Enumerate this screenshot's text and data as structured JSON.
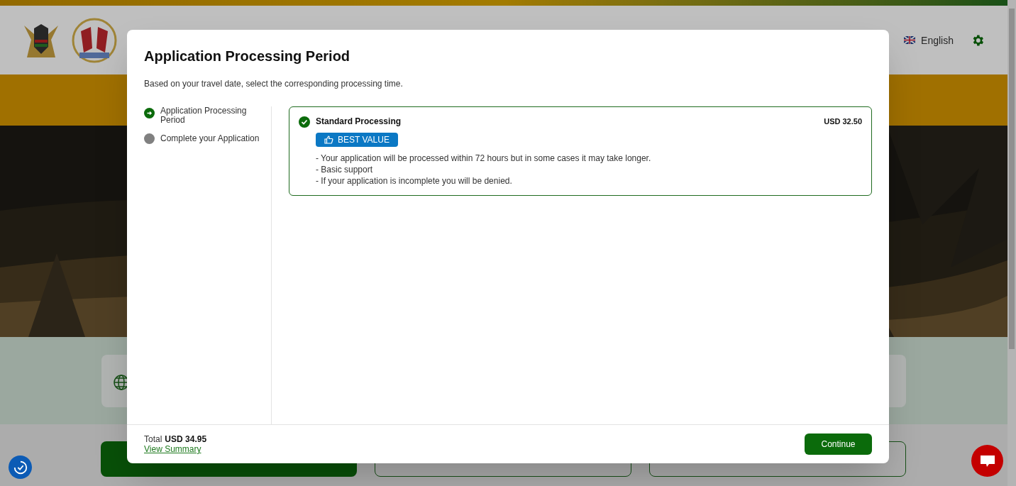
{
  "header": {
    "language": "English"
  },
  "modal": {
    "title": "Application Processing Period",
    "subtitle": "Based on your travel date, select the corresponding processing time.",
    "steps": [
      {
        "label": "Application Processing Period",
        "selected": true
      },
      {
        "label": "Complete your Application",
        "selected": false
      }
    ],
    "options": [
      {
        "name": "Standard Processing",
        "price": "USD 32.50",
        "badge": "BEST VALUE",
        "selected": true,
        "details": [
          "- Your application will be processed within 72 hours but in some cases it may take longer.",
          "- Basic support",
          "- If your application is incomplete you will be denied."
        ]
      }
    ],
    "total_label": "Total",
    "total_value": "USD 34.95",
    "summary_link": "View Summary",
    "continue_button": "Continue"
  }
}
